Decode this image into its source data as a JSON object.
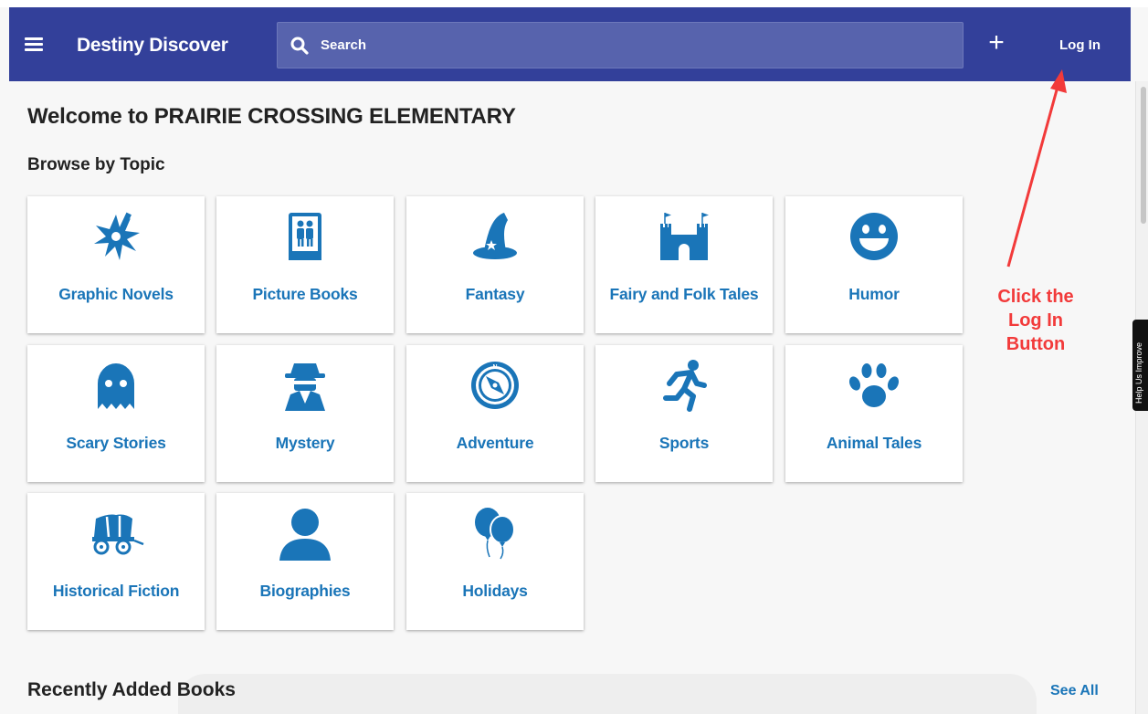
{
  "header": {
    "brand": "Destiny Discover",
    "search_placeholder": "Search",
    "add_label": "+",
    "login_label": "Log In"
  },
  "page": {
    "title": "Welcome to PRAIRIE CROSSING ELEMENTARY",
    "browse_title": "Browse by Topic"
  },
  "topics": [
    {
      "label": "Graphic Novels",
      "icon": "burst-icon"
    },
    {
      "label": "Picture Books",
      "icon": "picture-book-icon"
    },
    {
      "label": "Fantasy",
      "icon": "wizard-hat-icon"
    },
    {
      "label": "Fairy and Folk Tales",
      "icon": "castle-icon"
    },
    {
      "label": "Humor",
      "icon": "smiley-icon"
    },
    {
      "label": "Scary Stories",
      "icon": "ghost-icon"
    },
    {
      "label": "Mystery",
      "icon": "detective-icon"
    },
    {
      "label": "Adventure",
      "icon": "compass-icon"
    },
    {
      "label": "Sports",
      "icon": "runner-icon"
    },
    {
      "label": "Animal Tales",
      "icon": "paw-icon"
    },
    {
      "label": "Historical Fiction",
      "icon": "wagon-icon"
    },
    {
      "label": "Biographies",
      "icon": "person-icon"
    },
    {
      "label": "Holidays",
      "icon": "balloons-icon"
    }
  ],
  "annotation": {
    "line1": "Click the",
    "line2": "Log In",
    "line3": "Button",
    "color": "#f23a3a"
  },
  "help_tab": "Help Us Improve",
  "recent": {
    "title": "Recently Added Books",
    "see_all": "See All"
  },
  "colors": {
    "header_bg": "#33409a",
    "search_bg": "#5763ad",
    "topic_blue": "#1a75b8"
  }
}
